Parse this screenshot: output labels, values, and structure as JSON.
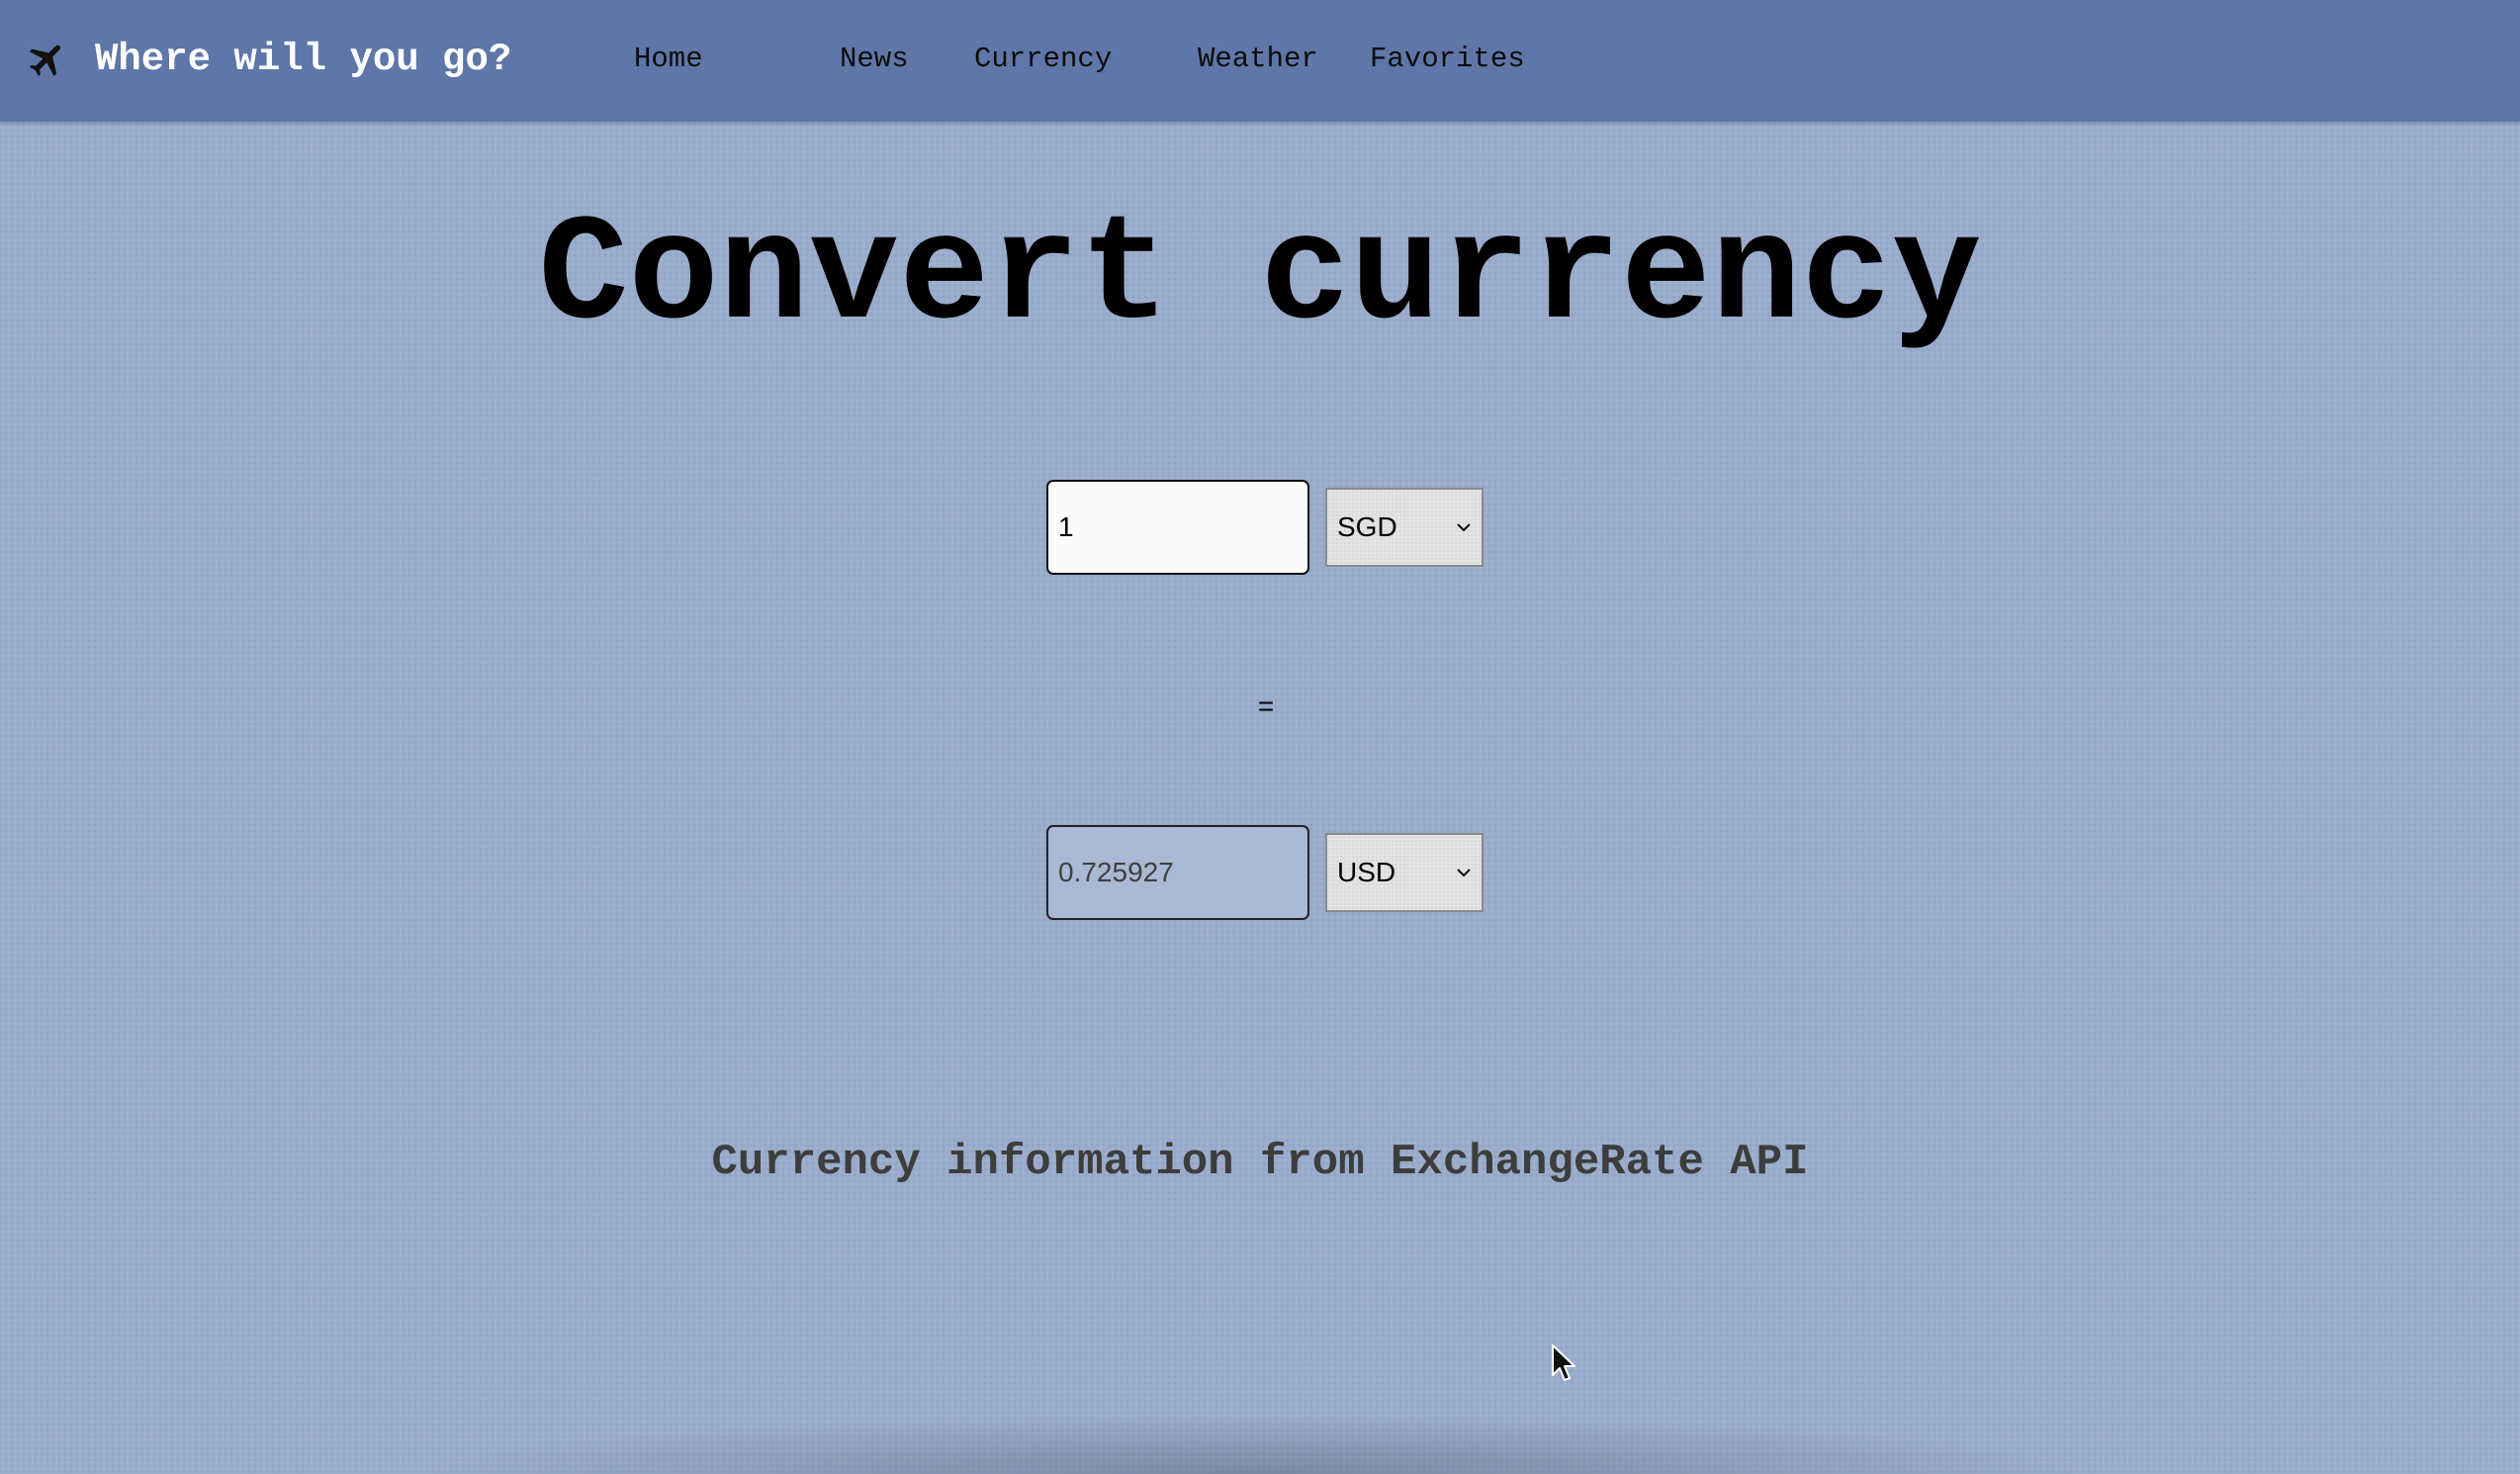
{
  "navbar": {
    "brand_title": "Where will you go?",
    "brand_icon": "airplane-icon",
    "links": {
      "home": "Home",
      "news": "News",
      "currency": "Currency",
      "weather": "Weather",
      "favorites": "Favorites"
    }
  },
  "main": {
    "title": "Convert currency",
    "converter": {
      "amount_value": "1",
      "from_currency": "SGD",
      "equals": "=",
      "result_value": "0.725927",
      "to_currency": "USD"
    },
    "attribution": "Currency information from ExchangeRate API"
  },
  "colors": {
    "navbar_bg": "#5e77a8",
    "page_bg": "#9aaccb",
    "brand_text": "#ffffff",
    "result_field_bg": "#a9b8d3"
  },
  "icons": {
    "select_chevron": "chevron-down-icon",
    "pointer": "mouse-cursor-icon"
  }
}
